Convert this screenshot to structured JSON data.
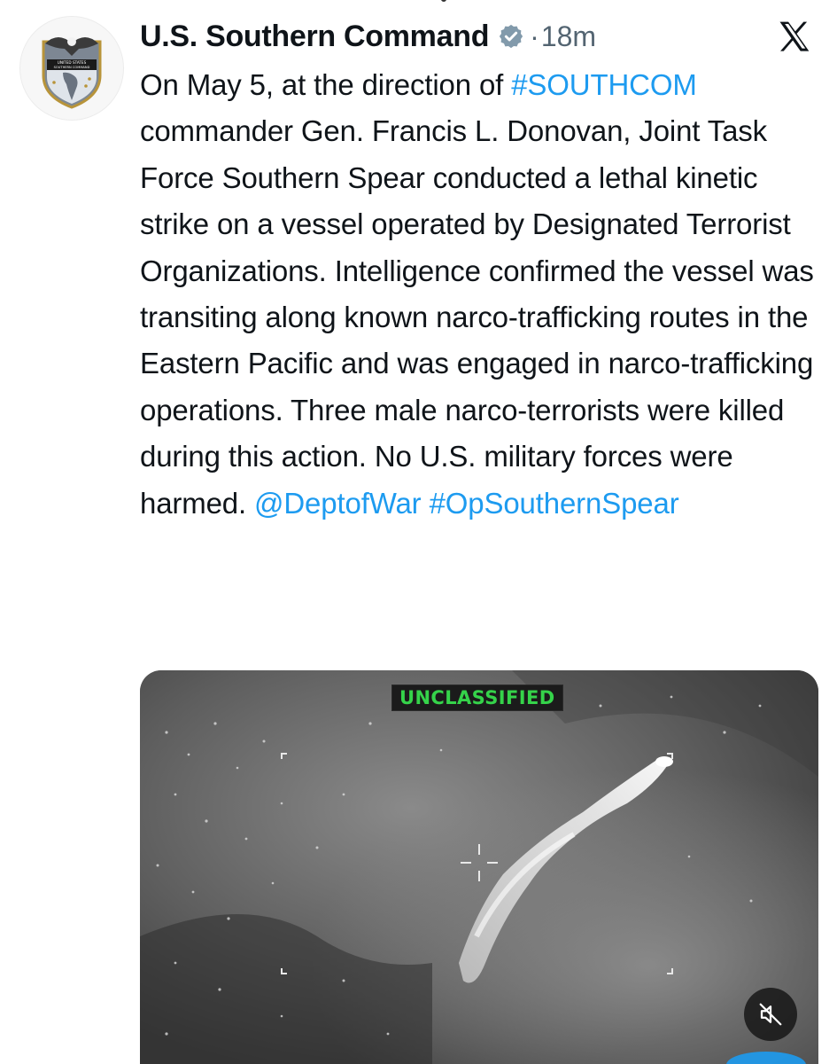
{
  "tweet": {
    "author_name": "U.S. Southern Command",
    "separator": "·",
    "time": "18m",
    "text_segments": [
      {
        "text": "On May 5, at the direction of ",
        "type": "text"
      },
      {
        "text": "#SOUTHCOM",
        "type": "link"
      },
      {
        "text": " commander Gen. Francis L. Donovan, Joint Task Force Southern Spear conducted a lethal kinetic strike on a vessel operated by Designated Terrorist Organizations. Intelligence confirmed the vessel was transiting along known narco-trafficking routes in the Eastern Pacific and was engaged in narco-trafficking operations. Three male narco-terrorists were killed during this action. No U.S. military forces were harmed. ",
        "type": "text"
      },
      {
        "text": "@DeptofWar",
        "type": "link"
      },
      {
        "text": " ",
        "type": "text"
      },
      {
        "text": "#OpSouthernSpear",
        "type": "link"
      }
    ]
  },
  "avatar": {
    "seal_text_line1": "UNITED STATES",
    "seal_text_line2": "SOUTHERN COMMAND"
  },
  "media": {
    "overlay_label": "UNCLASSIFIED",
    "mute_icon": "speaker-muted-icon"
  },
  "icons": {
    "verified": "verified-badge-icon",
    "platform": "x-logo-icon"
  },
  "colors": {
    "link": "#1d9bf0",
    "text": "#0f1419",
    "muted": "#536471",
    "overlay_green": "#35d34a"
  }
}
